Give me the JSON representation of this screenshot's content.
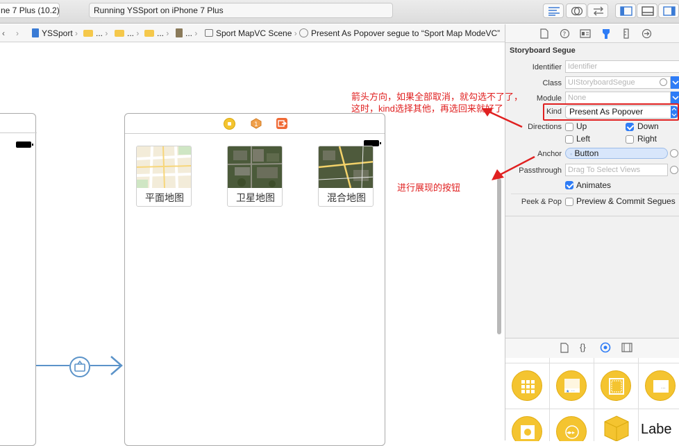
{
  "toolbar": {
    "scheme": "ne 7 Plus (10.2)",
    "activity": "Running YSSport on iPhone 7 Plus"
  },
  "jumpbar": {
    "items": [
      "YSSport",
      "...",
      "...",
      "...",
      "...",
      "Sport MapVC Scene",
      "Present As Popover segue to “Sport Map ModeVC”"
    ]
  },
  "canvas": {
    "map_buttons": [
      "平面地图",
      "卫星地图",
      "混合地图"
    ]
  },
  "annotations": {
    "note_line1": "箭头方向，如果全部取消，就勾选不了了，",
    "note_line2": "这时，kind选择其他，再选回来就好了",
    "note_anchor": "进行展现的按钮"
  },
  "inspector": {
    "section_title": "Storyboard Segue",
    "identifier_label": "Identifier",
    "identifier_placeholder": "Identifier",
    "class_label": "Class",
    "class_value": "UIStoryboardSegue",
    "module_label": "Module",
    "module_value": "None",
    "kind_label": "Kind",
    "kind_value": "Present As Popover",
    "directions_label": "Directions",
    "directions": [
      {
        "label": "Up",
        "checked": false
      },
      {
        "label": "Down",
        "checked": true
      },
      {
        "label": "Left",
        "checked": false
      },
      {
        "label": "Right",
        "checked": false
      }
    ],
    "anchor_label": "Anchor",
    "anchor_value": "Button",
    "passthrough_label": "Passthrough",
    "passthrough_placeholder": "Drag To Select Views",
    "animates_label": "Animates",
    "animates_checked": true,
    "peek_label": "Peek & Pop",
    "peek_value": "Preview & Commit Segues"
  },
  "library": {
    "label_item": "Labe"
  },
  "colors": {
    "annotation_red": "#e02020",
    "accent_blue": "#2e7cf6",
    "library_yellow": "#f4c430",
    "segue_blue": "#5b93c9"
  }
}
